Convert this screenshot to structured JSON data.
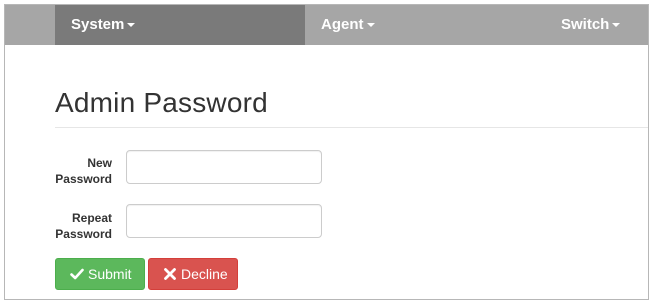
{
  "nav": {
    "items": [
      {
        "label": "System"
      },
      {
        "label": "Agent"
      },
      {
        "label": "Switch"
      }
    ]
  },
  "page": {
    "title": "Admin Password"
  },
  "form": {
    "new_password": {
      "label_line1": "New",
      "label_line2": "Password",
      "value": ""
    },
    "repeat_password": {
      "label_line1": "Repeat",
      "label_line2": "Password",
      "value": ""
    }
  },
  "actions": {
    "submit_label": "Submit",
    "decline_label": "Decline"
  },
  "colors": {
    "navbar": "#a6a6a6",
    "nav_active": "#7a7a7a",
    "submit": "#5cb85c",
    "decline": "#d9534f"
  },
  "icons": {
    "submit": "check-icon",
    "decline": "x-icon"
  }
}
